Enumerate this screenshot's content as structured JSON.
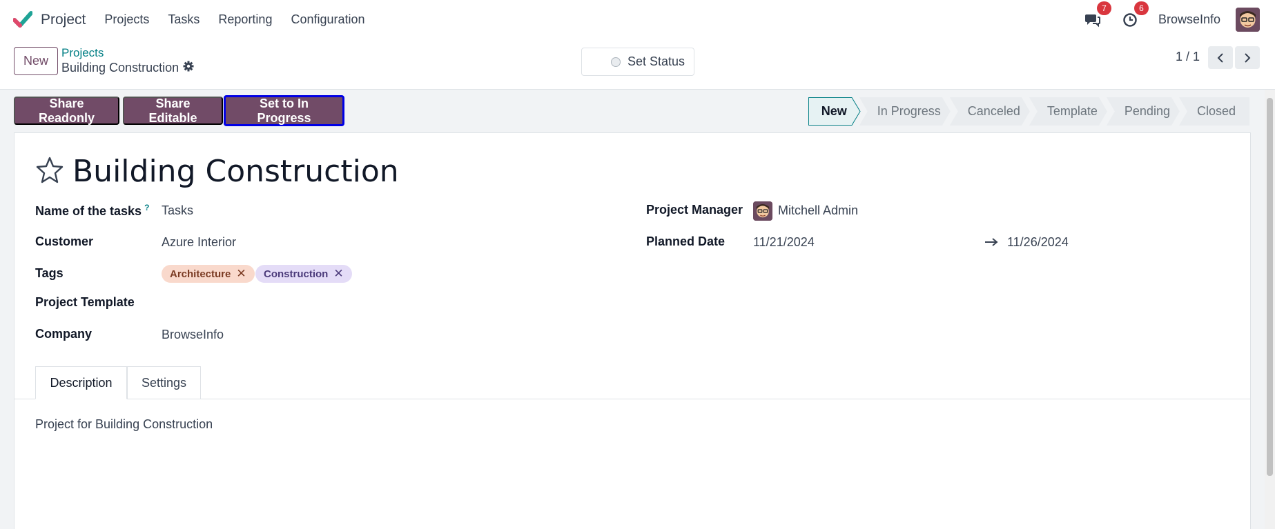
{
  "navbar": {
    "app_name": "Project",
    "menu": [
      "Projects",
      "Tasks",
      "Reporting",
      "Configuration"
    ],
    "messages_count": "7",
    "activities_count": "6",
    "company": "BrowseInfo"
  },
  "control": {
    "new_label": "New",
    "breadcrumb_parent": "Projects",
    "breadcrumb_current": "Building Construction",
    "set_status_label": "Set Status",
    "pager_value": "1 / 1"
  },
  "actions": {
    "share_readonly": "Share Readonly",
    "share_editable": "Share Editable",
    "set_in_progress": "Set to In Progress"
  },
  "stages": [
    "New",
    "In Progress",
    "Canceled",
    "Template",
    "Pending",
    "Closed"
  ],
  "active_stage": "New",
  "form": {
    "title": "Building Construction",
    "labels": {
      "task_name": "Name of the tasks",
      "help": "?",
      "customer": "Customer",
      "tags": "Tags",
      "template": "Project Template",
      "company": "Company",
      "manager": "Project Manager",
      "planned_date": "Planned Date"
    },
    "values": {
      "task_name": "Tasks",
      "customer": "Azure Interior",
      "company": "BrowseInfo",
      "manager": "Mitchell Admin",
      "date_start": "11/21/2024",
      "date_end": "11/26/2024"
    },
    "tags": [
      {
        "label": "Architecture",
        "x": "✕",
        "bg": "#f9d9cc",
        "fg": "#7a3a22"
      },
      {
        "label": "Construction",
        "x": "✕",
        "bg": "#e4dcf7",
        "fg": "#4b3a7a"
      }
    ]
  },
  "tabs": [
    "Description",
    "Settings"
  ],
  "description": "Project for Building Construction",
  "colors": {
    "primary": "#714b67",
    "link": "#017e84",
    "highlight_border": "#0000e5",
    "badge": "#d9363e"
  }
}
